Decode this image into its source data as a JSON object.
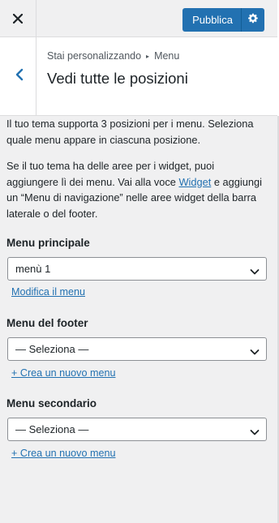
{
  "topbar": {
    "close_icon": "close-icon",
    "publish_label": "Pubblica",
    "settings_icon": "gear-icon",
    "accent": "#2271b1"
  },
  "section": {
    "back_icon": "chevron-left-icon",
    "breadcrumb_prefix": "Stai personalizzando",
    "breadcrumb_separator": "▸",
    "breadcrumb_current": "Menu",
    "title": "Vedi tutte le posizioni"
  },
  "intro": {
    "p1": "Il tuo tema supporta 3 posizioni per i menu. Seleziona quale menu appare in ciascuna posizione.",
    "p2_before": "Se il tuo tema ha delle aree per i widget, puoi aggiungere lì dei menu. Vai alla voce ",
    "p2_link": "Widget",
    "p2_after": " e aggiungi un “Menu di navigazione” nelle aree widget della barra laterale o del footer."
  },
  "locations": [
    {
      "label": "Menu principale",
      "selected": "menù 1",
      "link": "Modifica il menu"
    },
    {
      "label": "Menu del footer",
      "selected": "— Seleziona —",
      "link": "+ Crea un nuovo menu"
    },
    {
      "label": "Menu secondario",
      "selected": "— Seleziona —",
      "link": "+ Crea un nuovo menu"
    }
  ]
}
